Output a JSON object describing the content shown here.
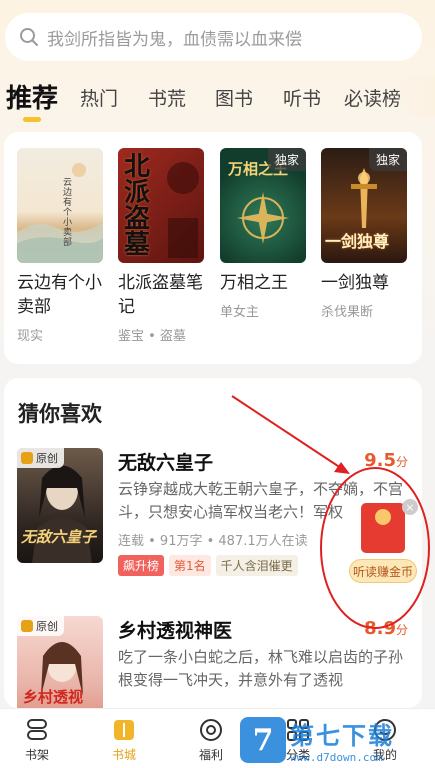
{
  "search": {
    "placeholder": "我剑所指皆为鬼，血债需以血来偿"
  },
  "tabs": [
    {
      "label": "推荐"
    },
    {
      "label": "热门"
    },
    {
      "label": "书荒"
    },
    {
      "label": "图书"
    },
    {
      "label": "听书"
    },
    {
      "label": "必读榜"
    }
  ],
  "top_books": [
    {
      "title": "云边有个小卖部",
      "tag": "现实",
      "cover_text": "云边有个小卖部",
      "exclusive": ""
    },
    {
      "title": "北派盗墓笔记",
      "tag": "鉴宝 • 盗墓",
      "cover_text": "北派盗墓",
      "exclusive": ""
    },
    {
      "title": "万相之王",
      "tag": "单女主",
      "cover_text": "万相之王",
      "exclusive": "独家"
    },
    {
      "title": "一剑独尊",
      "tag": "杀伐果断",
      "cover_text": "一剑独尊",
      "exclusive": "独家"
    }
  ],
  "section": {
    "title": "猜你喜欢"
  },
  "list": [
    {
      "badge": "原创",
      "title": "无敌六皇子",
      "score": "9.5",
      "score_unit": "分",
      "desc": "云铮穿越成大乾王朝六皇子，不夺嫡，不宫斗，只想安心搞军权当老六！军权",
      "meta": "连载 • 91万字 • 487.1万人在读",
      "tag_hot": "飙升榜",
      "tag_rank": "第1名",
      "tag_extra": "千人含泪催更",
      "cover_text": "无敌六皇子"
    },
    {
      "badge": "原创",
      "title": "乡村透视神医",
      "score": "8.9",
      "score_unit": "分",
      "desc": "吃了一条小白蛇之后，林飞难以启齿的子孙根变得一飞冲天，并意外有了透视",
      "meta": "",
      "cover_text": "乡村透视"
    }
  ],
  "redpack": {
    "label": "听读赚金币",
    "close": "×"
  },
  "bottom_nav": [
    {
      "label": "书架",
      "icon": "bookshelf-icon"
    },
    {
      "label": "书城",
      "icon": "bookstore-icon"
    },
    {
      "label": "福利",
      "icon": "welfare-icon"
    },
    {
      "label": "分类",
      "icon": "category-icon"
    },
    {
      "label": "我的",
      "icon": "profile-icon"
    }
  ],
  "watermark": {
    "brand": "第七下载",
    "url": "www.d7down.com",
    "logo_letter": "7"
  },
  "colors": {
    "accent": "#e6a117",
    "score": "#e85a2c",
    "hot_tag": "#f1625c",
    "annotation": "#e02020"
  }
}
